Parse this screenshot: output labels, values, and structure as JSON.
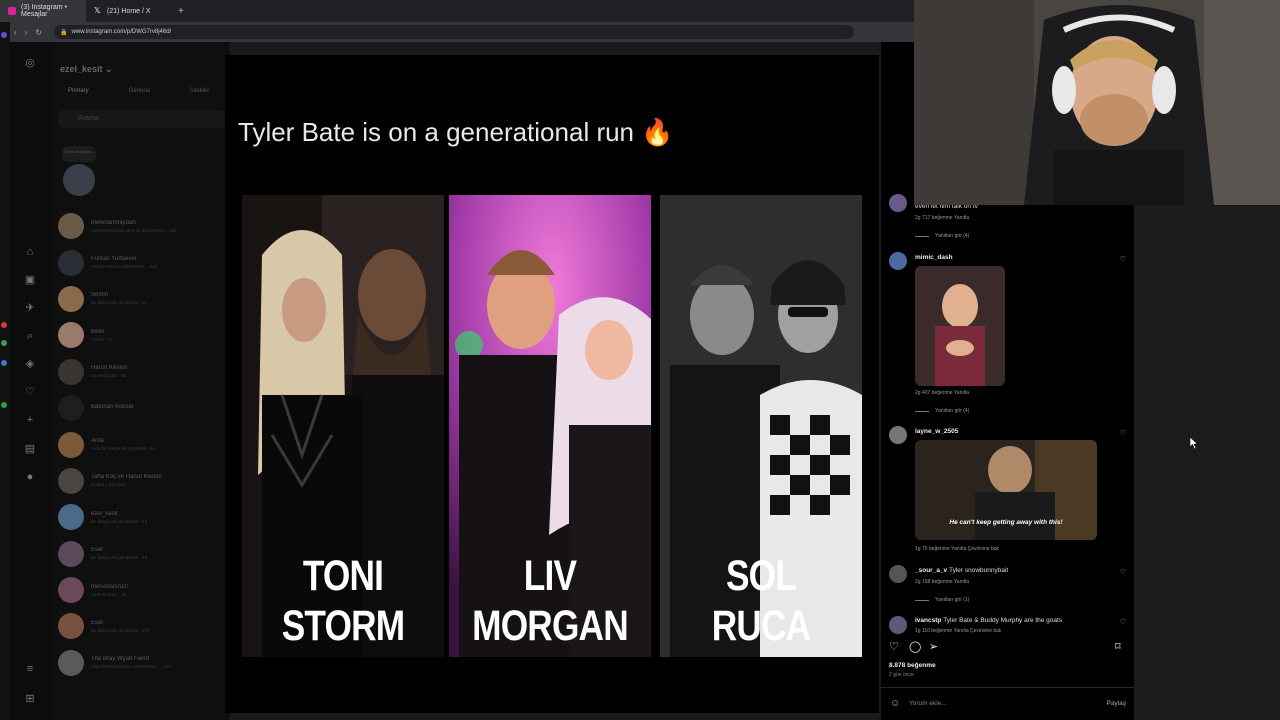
{
  "browser": {
    "tabs": [
      {
        "label": "(3) Instagram • Mesajlar",
        "favicon_color": "#d6249f"
      },
      {
        "label": "(21) Home / X",
        "favicon_color": "#ffffff"
      }
    ],
    "new_tab_glyph": "+",
    "url": "www.instagram.com/p/DWG7rv8j46d/"
  },
  "dm_panel": {
    "username": "ezel_kesit",
    "tabs": [
      "Primary",
      "General",
      "İstekler"
    ],
    "search_placeholder": "Arama",
    "note_text": "Şöyle dünyaya...",
    "conversations": [
      {
        "name": "metehanmeydan",
        "message": "metehanmeydan sent an attachment. · 2sb",
        "color": "#6b5a4a"
      },
      {
        "name": "Furkan Yurtsever",
        "message": "Furkan sent an attachment. · 4sb",
        "color": "#2a2d33"
      },
      {
        "name": "Semih",
        "message": "Bir dünya eki gönderdin · 3s",
        "color": "#8a6a4a"
      },
      {
        "name": "Bekir",
        "message": "Yorum · 3s",
        "color": "#9a7a6a"
      },
      {
        "name": "Harun Keskin",
        "message": "Bir mesaj attı · 5s",
        "color": "#3a3530"
      },
      {
        "name": "Batuhan Köksal",
        "message": "",
        "color": "#1e1e20"
      },
      {
        "name": "Arda",
        "message": "Arda bir dünya eki gönderdi · 6g",
        "color": "#7a5a3a"
      },
      {
        "name": "Taha Koç ve Harun Keskin",
        "message": "Dugün 1 kişi aktif",
        "color": "#4a4540"
      },
      {
        "name": "ezel_kesit",
        "message": "Bir dünya eki gönderdin · 1h",
        "color": "#4a6a8a"
      },
      {
        "name": "Esel",
        "message": "Bir dünya eki gönderdin · 1h",
        "color": "#5a4a5a"
      },
      {
        "name": "mesvinsion10",
        "message": "Cem ne kaza · 2h",
        "color": "#6a4a5a"
      },
      {
        "name": "Esel",
        "message": "Bir dünya eki gönderdin · 17h",
        "color": "#7a5040"
      },
      {
        "name": "The Bray Wyatt Fiend",
        "message": "https://www.youtube.com/shorts/... · 17h",
        "color": "#5a5a5a"
      }
    ]
  },
  "post": {
    "title": "Tyler Bate is on a generational run",
    "title_emoji": "🔥",
    "panels": [
      {
        "name_line1": "TONI",
        "name_line2": "STORM",
        "tone": "dark"
      },
      {
        "name_line1": "LIV",
        "name_line2": "MORGAN",
        "tone": "pink"
      },
      {
        "name_line1": "SOL",
        "name_line2": "RUCA",
        "tone": "mono"
      }
    ]
  },
  "comments": {
    "items": [
      {
        "text": "even let him talk on tv",
        "meta": "2g   717 beğenme   Yanıtla",
        "replies": "Yanıtları gör (4)"
      },
      {
        "user": "mimic_dash",
        "meta": "2g   407 beğenme   Yanıtla",
        "replies": "Yanıtları gör (4)"
      },
      {
        "user": "layne_w_2505",
        "gif_caption": "He can't keep getting away with this!",
        "meta": "1g   75 beğenme   Yanıtla   Çevirisine bak"
      },
      {
        "user": "_sour_a_v",
        "text": "Tyler snowbunnybait",
        "meta": "2g   158 beğenme   Yanıtla",
        "replies": "Yanıtları gör (1)"
      },
      {
        "user": "ivancstp",
        "text": "Tyler Bate & Buddy Murphy are the goats",
        "meta": "1g   110 beğenme   Yanıtla   Çevirisine bak"
      }
    ],
    "like_count": "8.878 beğenme",
    "posted_ago": "2 gün önce",
    "comment_placeholder": "Yorum ekle...",
    "share_label": "Paylaş"
  }
}
